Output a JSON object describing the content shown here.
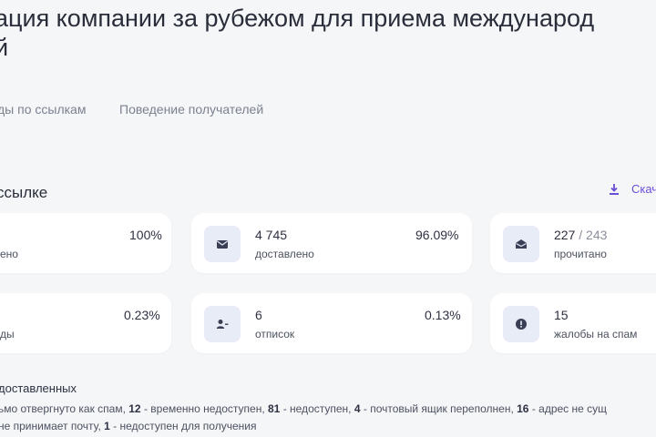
{
  "page": {
    "title_line1": "ация компании за рубежом для приема международ",
    "title_line2": "й"
  },
  "tabs": [
    {
      "label": "ды по ссылкам"
    },
    {
      "label": "Поведение получателей"
    }
  ],
  "section": {
    "title": "ссылке",
    "download_label": "Скач"
  },
  "cards": [
    {
      "pct": "100%",
      "label": "ено"
    },
    {
      "num": "4 745",
      "label": "доставлено",
      "pct": "96.09%",
      "icon": "envelope-icon"
    },
    {
      "num": "227",
      "num_suffix": " / 243",
      "label": "прочитано",
      "icon": "open-envelope-icon"
    },
    {
      "pct": "0.23%",
      "label": "ды"
    },
    {
      "num": "6",
      "label": "отписок",
      "pct": "0.13%",
      "icon": "user-minus-icon"
    },
    {
      "num": "15",
      "label": "жалобы на спам",
      "icon": "alert-icon"
    }
  ],
  "undelivered": {
    "title": "доставленных",
    "line1_a": "ьмо отвергнуто как спам, ",
    "n1": "12",
    "line1_b": " - временно недоступен, ",
    "n2": "81",
    "line1_c": " - недоступен, ",
    "n3": "4",
    "line1_d": " - почтовый ящик переполнен, ",
    "n4": "16",
    "line1_e": " - адрес не сущ",
    "line2_a": "не принимает почту, ",
    "n5": "1",
    "line2_b": " - недоступен для получения"
  },
  "colors": {
    "accent": "#6b4fd8",
    "icon_bg": "#e8ecf7",
    "icon_fg": "#3a3f55",
    "page_bg": "#f5f6f8"
  }
}
